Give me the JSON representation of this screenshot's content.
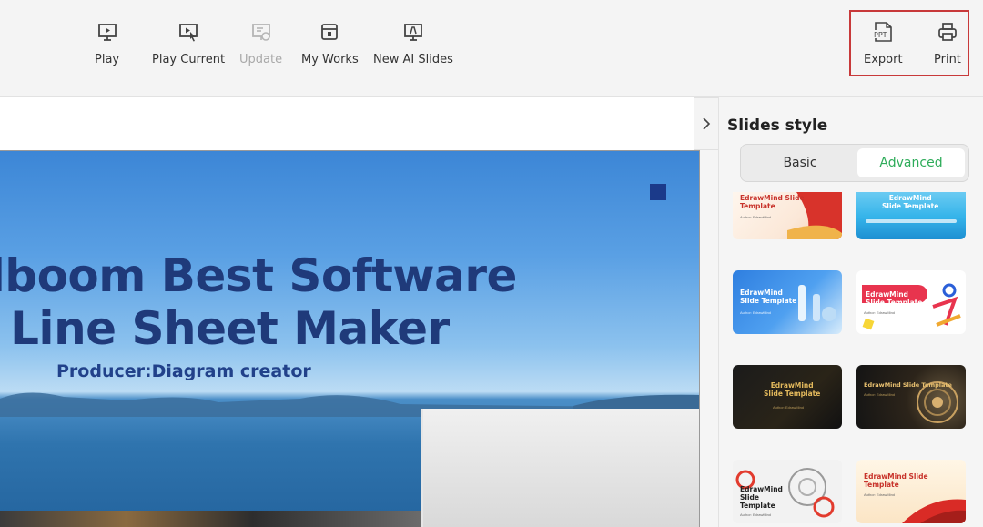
{
  "toolbar": {
    "play": {
      "label": "Play",
      "icon": "play-icon"
    },
    "play_current": {
      "label": "Play Current",
      "icon": "play-current-icon"
    },
    "update": {
      "label": "Update",
      "icon": "update-icon",
      "disabled": true
    },
    "my_works": {
      "label": "My Works",
      "icon": "my-works-icon"
    },
    "new_ai_slides": {
      "label": "New AI Slides",
      "icon": "new-ai-slides-icon"
    },
    "export": {
      "label": "Export",
      "icon": "ppt-export-icon",
      "icon_text": "PPT"
    },
    "print": {
      "label": "Print",
      "icon": "printer-icon"
    },
    "highlight_color": "#c8393a"
  },
  "slide": {
    "title_line1": "dboom Best Software",
    "title_line2": "r Line Sheet Maker",
    "producer": "Producer:Diagram creator",
    "title_color": "#1f3a7a"
  },
  "panel": {
    "collapse_icon": "chevron-right-icon",
    "title": "Slides style",
    "tabs": [
      {
        "label": "Basic",
        "selected": false
      },
      {
        "label": "Advanced",
        "selected": true
      }
    ],
    "accent_color": "#2eac5a",
    "templates": [
      {
        "title": "EdrawMind Slide\nTemplate",
        "subtitle": "Author: EdrawMind"
      },
      {
        "title": "EdrawMind\nSlide Template",
        "subtitle": ""
      },
      {
        "title": "EdrawMind\nSlide Template",
        "subtitle": "Author: EdrawMind"
      },
      {
        "title": "EdrawMind\nSlide Template",
        "subtitle": "Author: EdrawMind"
      },
      {
        "title": "EdrawMind\nSlide Template",
        "subtitle": "Author: EdrawMind"
      },
      {
        "title": "EdrawMind Slide Template",
        "subtitle": "Author: EdrawMind"
      },
      {
        "title": "EdrawMind\nSlide\nTemplate",
        "subtitle": "Author: EdrawMind"
      },
      {
        "title": "EdrawMind Slide\nTemplate",
        "subtitle": "Author: EdrawMind"
      }
    ]
  }
}
